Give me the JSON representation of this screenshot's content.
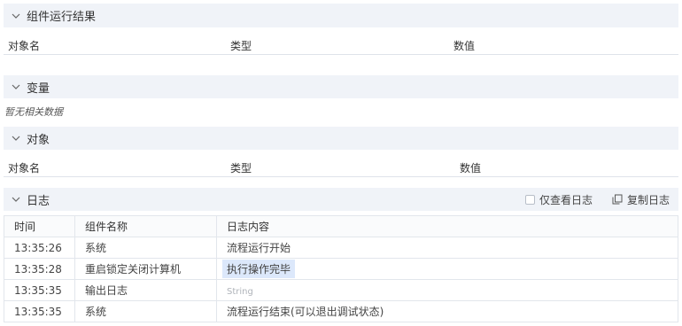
{
  "results_section": {
    "title": "组件运行结果",
    "columns": [
      "对象名",
      "类型",
      "数值"
    ]
  },
  "variables_section": {
    "title": "变量",
    "empty_text": "暂无相关数据"
  },
  "objects_section": {
    "title": "对象",
    "columns": [
      "对象名",
      "类型",
      "数值"
    ]
  },
  "log_section": {
    "title": "日志",
    "only_view_log_label": "仅查看日志",
    "copy_log_label": "复制日志",
    "columns": [
      "时间",
      "组件名称",
      "日志内容"
    ],
    "rows": [
      {
        "time": "13:35:26",
        "component": "系统",
        "content": "流程运行开始"
      },
      {
        "time": "13:35:28",
        "component": "重启锁定关闭计算机",
        "content": "执行操作完毕"
      },
      {
        "time": "13:35:35",
        "component": "输出日志",
        "content": "String"
      },
      {
        "time": "13:35:35",
        "component": "系统",
        "content": "流程运行结束(可以退出调试状态)"
      }
    ]
  }
}
